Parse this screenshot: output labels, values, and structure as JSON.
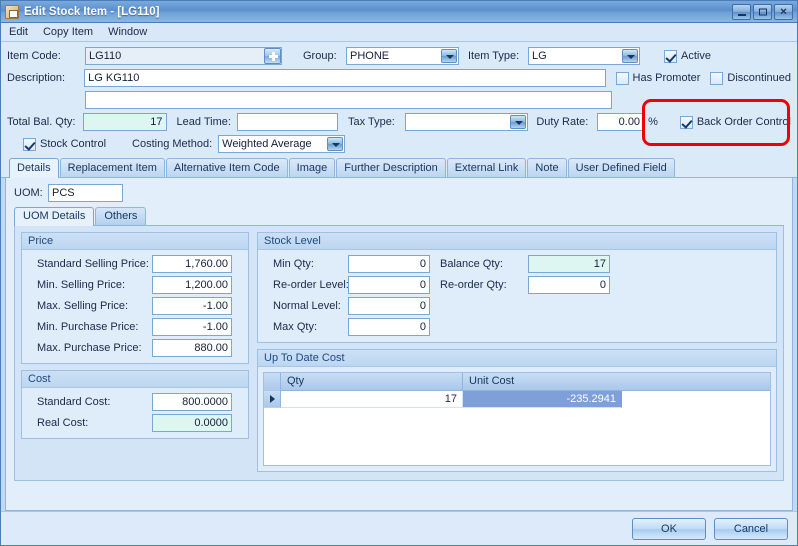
{
  "window": {
    "title": "Edit Stock Item - [LG110]",
    "icon": "stock-item-icon",
    "minimize": "_",
    "maximize": "□",
    "close": "✕"
  },
  "menu": [
    "Edit",
    "Copy Item",
    "Window"
  ],
  "header": {
    "item_code_label": "Item Code:",
    "item_code_value": "LG110",
    "group_label": "Group:",
    "group_value": "PHONE",
    "item_type_label": "Item Type:",
    "item_type_value": "LG",
    "active_label": "Active",
    "active_checked": true,
    "description_label": "Description:",
    "description_line1": "LG KG110",
    "description_line2": "",
    "has_promoter_label": "Has Promoter",
    "has_promoter_checked": false,
    "discontinued_label": "Discontinued",
    "discontinued_checked": false,
    "total_bal_qty_label": "Total Bal. Qty:",
    "total_bal_qty_value": "17",
    "lead_time_label": "Lead Time:",
    "lead_time_value": "",
    "tax_type_label": "Tax Type:",
    "tax_type_value": "",
    "duty_rate_label": "Duty Rate:",
    "duty_rate_value": "0.00",
    "percent_symbol": "%",
    "back_order_control_label": "Back Order Control",
    "back_order_control_checked": true,
    "stock_control_label": "Stock Control",
    "stock_control_checked": true,
    "costing_method_label": "Costing Method:",
    "costing_method_value": "Weighted Average",
    "highlight_color": "#f00000"
  },
  "tabs": [
    {
      "label": "Details",
      "active": true
    },
    {
      "label": "Replacement Item",
      "active": false
    },
    {
      "label": "Alternative Item Code",
      "active": false
    },
    {
      "label": "Image",
      "active": false
    },
    {
      "label": "Further Description",
      "active": false
    },
    {
      "label": "External Link",
      "active": false
    },
    {
      "label": "Note",
      "active": false
    },
    {
      "label": "User Defined Field",
      "active": false
    }
  ],
  "details": {
    "uom_label": "UOM:",
    "uom_value": "PCS",
    "inner_tabs": [
      {
        "label": "UOM Details",
        "active": true
      },
      {
        "label": "Others",
        "active": false
      }
    ],
    "price_group": {
      "title": "Price",
      "fields": [
        {
          "label": "Standard Selling Price:",
          "value": "1,760.00"
        },
        {
          "label": "Min. Selling Price:",
          "value": "1,200.00"
        },
        {
          "label": "Max. Selling Price:",
          "value": "-1.00"
        },
        {
          "label": "Min. Purchase Price:",
          "value": "-1.00"
        },
        {
          "label": "Max. Purchase Price:",
          "value": "880.00"
        }
      ]
    },
    "cost_group": {
      "title": "Cost",
      "fields": [
        {
          "label": "Standard Cost:",
          "value": "800.0000",
          "readonly": false
        },
        {
          "label": "Real Cost:",
          "value": "0.0000",
          "readonly": true
        }
      ]
    },
    "stock_level_group": {
      "title": "Stock Level",
      "left_fields": [
        {
          "label": "Min Qty:",
          "value": "0"
        },
        {
          "label": "Re-order Level:",
          "value": "0"
        },
        {
          "label": "Normal Level:",
          "value": "0"
        },
        {
          "label": "Max Qty:",
          "value": "0"
        }
      ],
      "right_fields": [
        {
          "label": "Balance Qty:",
          "value": "17",
          "readonly": true
        },
        {
          "label": "Re-order Qty:",
          "value": "0",
          "readonly": false
        }
      ]
    },
    "up_to_date_cost_group": {
      "title": "Up To Date Cost",
      "columns": [
        "Qty",
        "Unit Cost"
      ],
      "rows": [
        {
          "qty": "17",
          "unit_cost": "-235.2941",
          "selected_cell": "unit_cost"
        }
      ]
    }
  },
  "footer": {
    "ok_label": "OK",
    "cancel_label": "Cancel"
  }
}
